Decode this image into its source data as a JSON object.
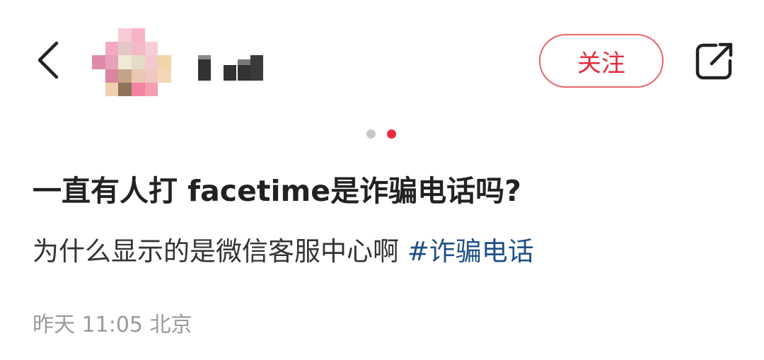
{
  "header": {
    "follow_label": "关注",
    "username_masked": "███"
  },
  "carousel": {
    "total": 2,
    "active_index": 1
  },
  "post": {
    "title": "一直有人打 facetime是诈骗电话吗?",
    "body": "为什么显示的是微信客服中心啊 ",
    "hashtag": "#诈骗电话",
    "time": "昨天 11:05",
    "location": "北京"
  },
  "colors": {
    "accent": "#e02d3c",
    "hashtag": "#1f4f84",
    "meta": "#9b9b9b",
    "dot_active": "#ee2a3e",
    "dot_inactive": "#c8c8c8"
  }
}
